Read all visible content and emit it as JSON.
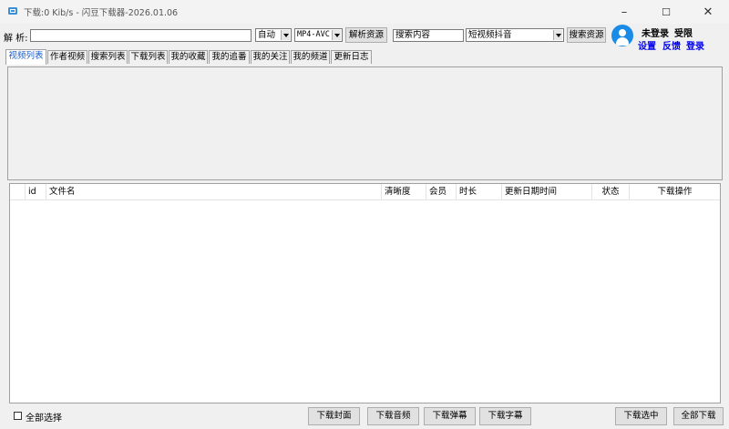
{
  "window": {
    "title": "下载:0 Kib/s - 闪豆下载器-2026.01.06",
    "minimize": "–",
    "maximize": "☐",
    "close": "✕"
  },
  "toolbar": {
    "parse_label": "解  析:",
    "url_value": "",
    "mode_select": "自动",
    "format_select": "MP4-AVC",
    "parse_button": "解析资源",
    "search_value": "搜索内容",
    "platform_select": "短视频抖音",
    "search_button": "搜索资源"
  },
  "user": {
    "status": "未登录",
    "quota": "受限",
    "settings": "设置",
    "feedback": "反馈",
    "login": "登录"
  },
  "tabs": [
    "视频列表",
    "作者视频",
    "搜索列表",
    "下载列表",
    "我的收藏",
    "我的追番",
    "我的关注",
    "我的频道",
    "更新日志"
  ],
  "table": {
    "columns": [
      "",
      "id",
      "文件名",
      "清晰度",
      "会员",
      "时长",
      "更新日期时间",
      "状态",
      "下载操作"
    ],
    "rows": []
  },
  "bottom": {
    "select_all": "全部选择",
    "download_cover": "下载封面",
    "download_audio": "下载音频",
    "download_danmaku": "下载弹幕",
    "download_subtitle": "下载字幕",
    "download_selected": "下载选中",
    "download_all": "全部下载"
  },
  "colors": {
    "accent": "#1a8ce8",
    "link": "#0000ee",
    "active_tab_text": "#1a5cc8"
  }
}
